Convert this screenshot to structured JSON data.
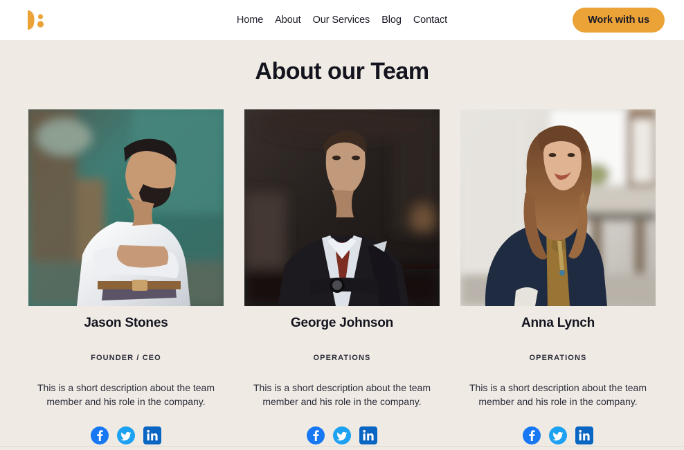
{
  "theme": {
    "accent": "#eba337",
    "page_background": "#efebe4",
    "header_background": "#ffffff",
    "text": "#1b1b28",
    "facebook_blue": "#1877f2",
    "twitter_blue": "#1da1f2",
    "linkedin_blue": "#0a66c2"
  },
  "header": {
    "logo_name": "brand-logo",
    "nav": [
      {
        "label": "Home"
      },
      {
        "label": "About"
      },
      {
        "label": "Our Services"
      },
      {
        "label": "Blog"
      },
      {
        "label": "Contact"
      }
    ],
    "cta_label": "Work with us"
  },
  "main": {
    "title": "About our Team",
    "members": [
      {
        "name": "Jason Stones",
        "role": "FOUNDER / CEO",
        "bio": "This is a short description about the team member and his role in the company.",
        "photo_alt": "Man in white dress shirt with arms crossed in front of a teal glass building",
        "socials": [
          {
            "network": "facebook",
            "label": "Facebook"
          },
          {
            "network": "twitter",
            "label": "Twitter"
          },
          {
            "network": "linkedin",
            "label": "LinkedIn"
          }
        ]
      },
      {
        "name": "George Johnson",
        "role": "OPERATIONS",
        "bio": "This is a short description about the team member and his role in the company.",
        "photo_alt": "Man in a dark suit with a red tie standing with arms crossed in a dim room",
        "socials": [
          {
            "network": "facebook",
            "label": "Facebook"
          },
          {
            "network": "twitter",
            "label": "Twitter"
          },
          {
            "network": "linkedin",
            "label": "LinkedIn"
          }
        ]
      },
      {
        "name": "Anna Lynch",
        "role": "OPERATIONS",
        "bio": "This is a short description about the team member and his role in the company.",
        "photo_alt": "Smiling woman with long brown hair in a navy blazer leaning on a wall in a bright office",
        "socials": [
          {
            "network": "facebook",
            "label": "Facebook"
          },
          {
            "network": "twitter",
            "label": "Twitter"
          },
          {
            "network": "linkedin",
            "label": "LinkedIn"
          }
        ]
      }
    ]
  }
}
